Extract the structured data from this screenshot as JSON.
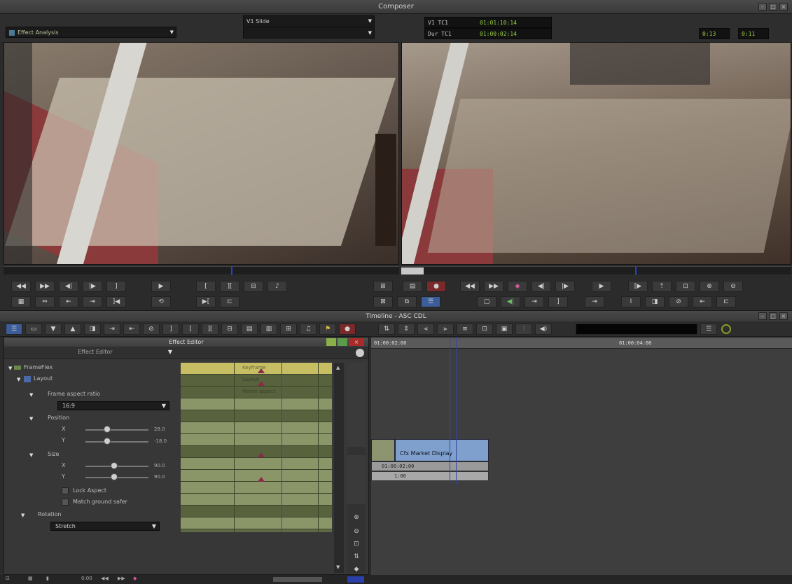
{
  "composer": {
    "title": "Composer"
  },
  "header": {
    "effect_menu": "Effect Analysis",
    "source_clip": "V1 Slide",
    "tc1_label": "V1 TC1",
    "tc1_value": "01:01:10:14",
    "tc2_label": "Dur TC1",
    "tc2_value": "01:00:02:14",
    "counter_left": "0:13",
    "counter_right": "0:11"
  },
  "timeline": {
    "title": "Timeline - ASC CDL",
    "ruler_tc1": "01:00:02:00",
    "ruler_tc2": "01:00:04:00",
    "clip_label": "Cfx Market Display",
    "clip_tc": "01:00:02:00",
    "clip_tc2": "1:00"
  },
  "effect_editor": {
    "title": "Effect Editor",
    "subtitle": "Effect Editor",
    "root": "FrameFlex",
    "layout": "Layout",
    "frame_aspect": "Frame aspect ratio",
    "frame_aspect_value": "16:9",
    "position": "Position",
    "pos_x_label": "X",
    "pos_x_value": "28.0",
    "pos_y_label": "Y",
    "pos_y_value": "-18.0",
    "size": "Size",
    "size_x_label": "X",
    "size_x_value": "90.0",
    "size_y_label": "Y",
    "size_y_value": "90.0",
    "lock_aspect": "Lock Aspect",
    "match_pos": "Match ground safer",
    "rotation": "Rotation",
    "rotation_value": "Stretch",
    "kf_label1": "Keyframe",
    "kf_label2": "Layout",
    "kf_label3": "Frame aspect"
  },
  "bottom": {
    "tc": "0:00"
  },
  "colors": {
    "accent_blue": "#3d5d9a",
    "timecode_green": "#9bcf48",
    "kf_green": "#8a9668",
    "kf_yellow": "#c7bd62",
    "clip_blue": "#7fa0cc"
  }
}
